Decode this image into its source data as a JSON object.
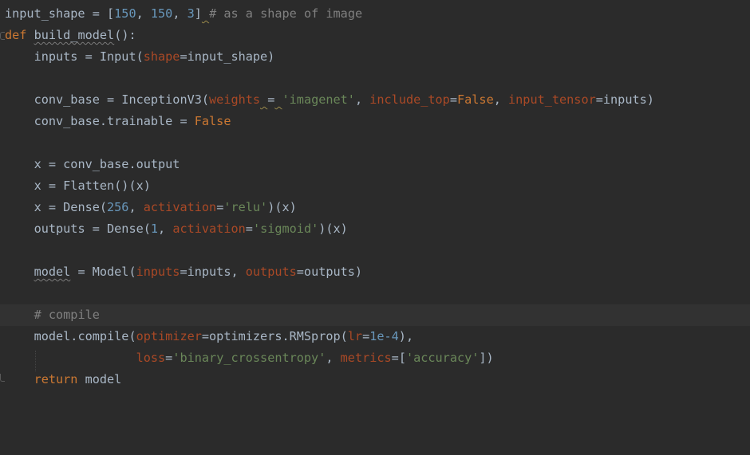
{
  "editor": {
    "theme_colors": {
      "background": "#2b2b2b",
      "current_line": "#323232",
      "default_text": "#a9b7c6",
      "number": "#6897bb",
      "string": "#6a8759",
      "keyword": "#cc7832",
      "parameter": "#aa4926",
      "comment": "#808080"
    },
    "lines": [
      {
        "t1": "input_shape = [",
        "n1": "150",
        "t2": ", ",
        "n2": "150",
        "t3": ", ",
        "n3": "3",
        "t4": "]",
        "t5": " ",
        "c": "# as a shape of image"
      },
      {
        "kw": "def",
        "t1": " ",
        "fn": "build_model",
        "t2": "():"
      },
      {
        "indent": "    ",
        "t1": "inputs = Input(",
        "p1": "shape",
        "t2": "=input_shape)"
      },
      {},
      {
        "indent": "    ",
        "t1": "conv_base = InceptionV3(",
        "p1": "weights",
        "t2": " ",
        "t3": "=",
        "t4": " ",
        "s1": "'imagenet'",
        "t5": ", ",
        "p2": "include_top",
        "t6": "=",
        "k1": "False",
        "t7": ", ",
        "p3": "input_tensor",
        "t8": "=inputs)"
      },
      {
        "indent": "    ",
        "t1": "conv_base.trainable = ",
        "k1": "False"
      },
      {},
      {
        "indent": "    ",
        "t1": "x = conv_base.output"
      },
      {
        "indent": "    ",
        "t1": "x = Flatten()(x)"
      },
      {
        "indent": "    ",
        "t1": "x = Dense(",
        "n1": "256",
        "t2": ", ",
        "p1": "activation",
        "t3": "=",
        "s1": "'relu'",
        "t4": ")(x)"
      },
      {
        "indent": "    ",
        "t1": "outputs = Dense(",
        "n1": "1",
        "t2": ", ",
        "p1": "activation",
        "t3": "=",
        "s1": "'sigmoid'",
        "t4": ")(x)"
      },
      {},
      {
        "indent": "    ",
        "t0": "model",
        "t1": " = Model(",
        "p1": "inputs",
        "t2": "=inputs, ",
        "p2": "outputs",
        "t3": "=outputs)"
      },
      {},
      {
        "indent": "    ",
        "c": "# compile"
      },
      {
        "indent": "    ",
        "t1": "model.compile(",
        "p1": "optimizer",
        "t2": "=optimizers.RMSprop(",
        "p2": "lr",
        "t3": "=",
        "n1": "1e-4",
        "t4": "),"
      },
      {
        "indent": "                  ",
        "p1": "loss",
        "t1": "=",
        "s1": "'binary_crossentropy'",
        "t2": ", ",
        "p2": "metrics",
        "t3": "=[",
        "s2": "'accuracy'",
        "t4": "])"
      },
      {
        "indent": "    ",
        "kw": "return",
        "t1": " model"
      }
    ]
  }
}
